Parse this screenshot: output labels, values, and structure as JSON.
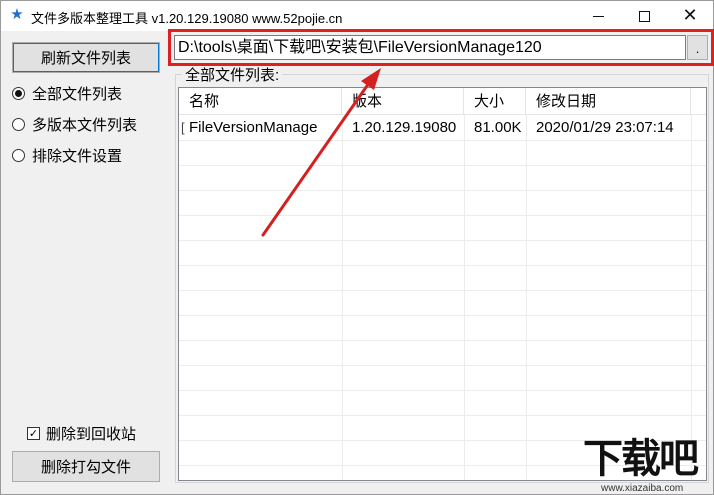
{
  "window": {
    "title": "文件多版本整理工具 v1.20.129.19080 www.52pojie.cn",
    "app_icon": "star-icon",
    "close_glyph": "✕"
  },
  "sidebar": {
    "refresh_label": "刷新文件列表",
    "options": [
      {
        "label": "全部文件列表",
        "checked": true
      },
      {
        "label": "多版本文件列表",
        "checked": false
      },
      {
        "label": "排除文件设置",
        "checked": false
      }
    ],
    "recycle_label": "删除到回收站",
    "recycle_checked": true,
    "recycle_check_glyph": "✓",
    "delete_label": "删除打勾文件"
  },
  "path_bar": {
    "value": "D:\\tools\\桌面\\下载吧\\安装包\\FileVersionManage120",
    "browse_label": "."
  },
  "file_list": {
    "group_label": "全部文件列表:",
    "columns": [
      "名称",
      "版本",
      "大小",
      "修改日期"
    ],
    "rows": [
      {
        "mark": "[",
        "name": "FileVersionManage",
        "version": "1.20.129.19080",
        "size": "81.00K",
        "modified": "2020/01/29 23:07:14"
      }
    ]
  },
  "annotation": {
    "highlight_color": "#e02020"
  },
  "watermark": {
    "logo": "下载吧",
    "url": "www.xiazaiba.com"
  }
}
